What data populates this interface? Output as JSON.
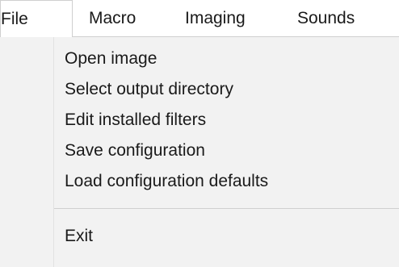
{
  "menubar": {
    "items": [
      {
        "label": "File"
      },
      {
        "label": "Macro"
      },
      {
        "label": "Imaging"
      },
      {
        "label": "Sounds"
      }
    ]
  },
  "file_menu": {
    "items": [
      {
        "label": "Open image"
      },
      {
        "label": "Select output directory"
      },
      {
        "label": "Edit installed filters"
      },
      {
        "label": "Save configuration"
      },
      {
        "label": "Load configuration defaults"
      }
    ],
    "exit_label": "Exit"
  }
}
